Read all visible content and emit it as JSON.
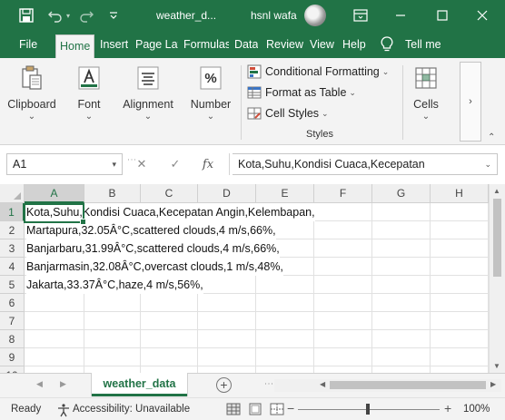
{
  "titlebar": {
    "title": "weather_d...",
    "user": "hsnl wafa"
  },
  "ribbon_tabs": [
    "File",
    "Home",
    "Insert",
    "Page Layout",
    "Formulas",
    "Data",
    "Review",
    "View",
    "Help",
    "Tell me"
  ],
  "ribbon": {
    "clipboard": "Clipboard",
    "font": "Font",
    "alignment": "Alignment",
    "number": "Number",
    "conditional_formatting": "Conditional Formatting",
    "format_as_table": "Format as Table",
    "cell_styles": "Cell Styles",
    "styles_group": "Styles",
    "cells": "Cells",
    "number_icon_text": "%"
  },
  "formula_bar": {
    "name_box": "A1",
    "fx": "fx",
    "content": "Kota,Suhu,Kondisi Cuaca,Kecepatan"
  },
  "sheet": {
    "columns": [
      "A",
      "B",
      "C",
      "D",
      "E",
      "F",
      "G",
      "H"
    ],
    "rows": [
      "1",
      "2",
      "3",
      "4",
      "5",
      "6",
      "7",
      "8",
      "9",
      "10"
    ],
    "cells": [
      "Kota,Suhu,Kondisi Cuaca,Kecepatan Angin,Kelembapan,",
      "Martapura,32.05Â°C,scattered clouds,4 m/s,66%,",
      "Banjarbaru,31.99Â°C,scattered clouds,4 m/s,66%,",
      "Banjarmasin,32.08Â°C,overcast clouds,1 m/s,48%,",
      "Jakarta,33.37Â°C,haze,4 m/s,56%,"
    ]
  },
  "sheet_tab": "weather_data",
  "statusbar": {
    "ready": "Ready",
    "accessibility": "Accessibility: Unavailable",
    "zoom": "100%"
  },
  "colors": {
    "brand": "#217346",
    "ribbon_bg": "#f3f3f3"
  }
}
